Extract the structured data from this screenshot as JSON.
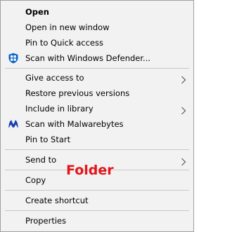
{
  "menu": {
    "items": [
      {
        "label": "Open"
      },
      {
        "label": "Open in new window"
      },
      {
        "label": "Pin to Quick access"
      },
      {
        "label": "Scan with Windows Defender...",
        "icon": "windows-defender-shield-icon"
      },
      {
        "label": "Give access to"
      },
      {
        "label": "Restore previous versions"
      },
      {
        "label": "Include in library"
      },
      {
        "label": "Scan with Malwarebytes",
        "icon": "malwarebytes-icon"
      },
      {
        "label": "Pin to Start"
      },
      {
        "label": "Send to"
      },
      {
        "label": "Copy"
      },
      {
        "label": "Create shortcut"
      },
      {
        "label": "Properties"
      }
    ]
  },
  "overlay": {
    "text": "Folder",
    "color": "#e2161b"
  },
  "colors": {
    "menu_background": "#f2f2f2",
    "separator": "#c8c8c8",
    "defender_blue": "#0a64c8",
    "malwarebytes_blue": "#1a3fb0"
  }
}
